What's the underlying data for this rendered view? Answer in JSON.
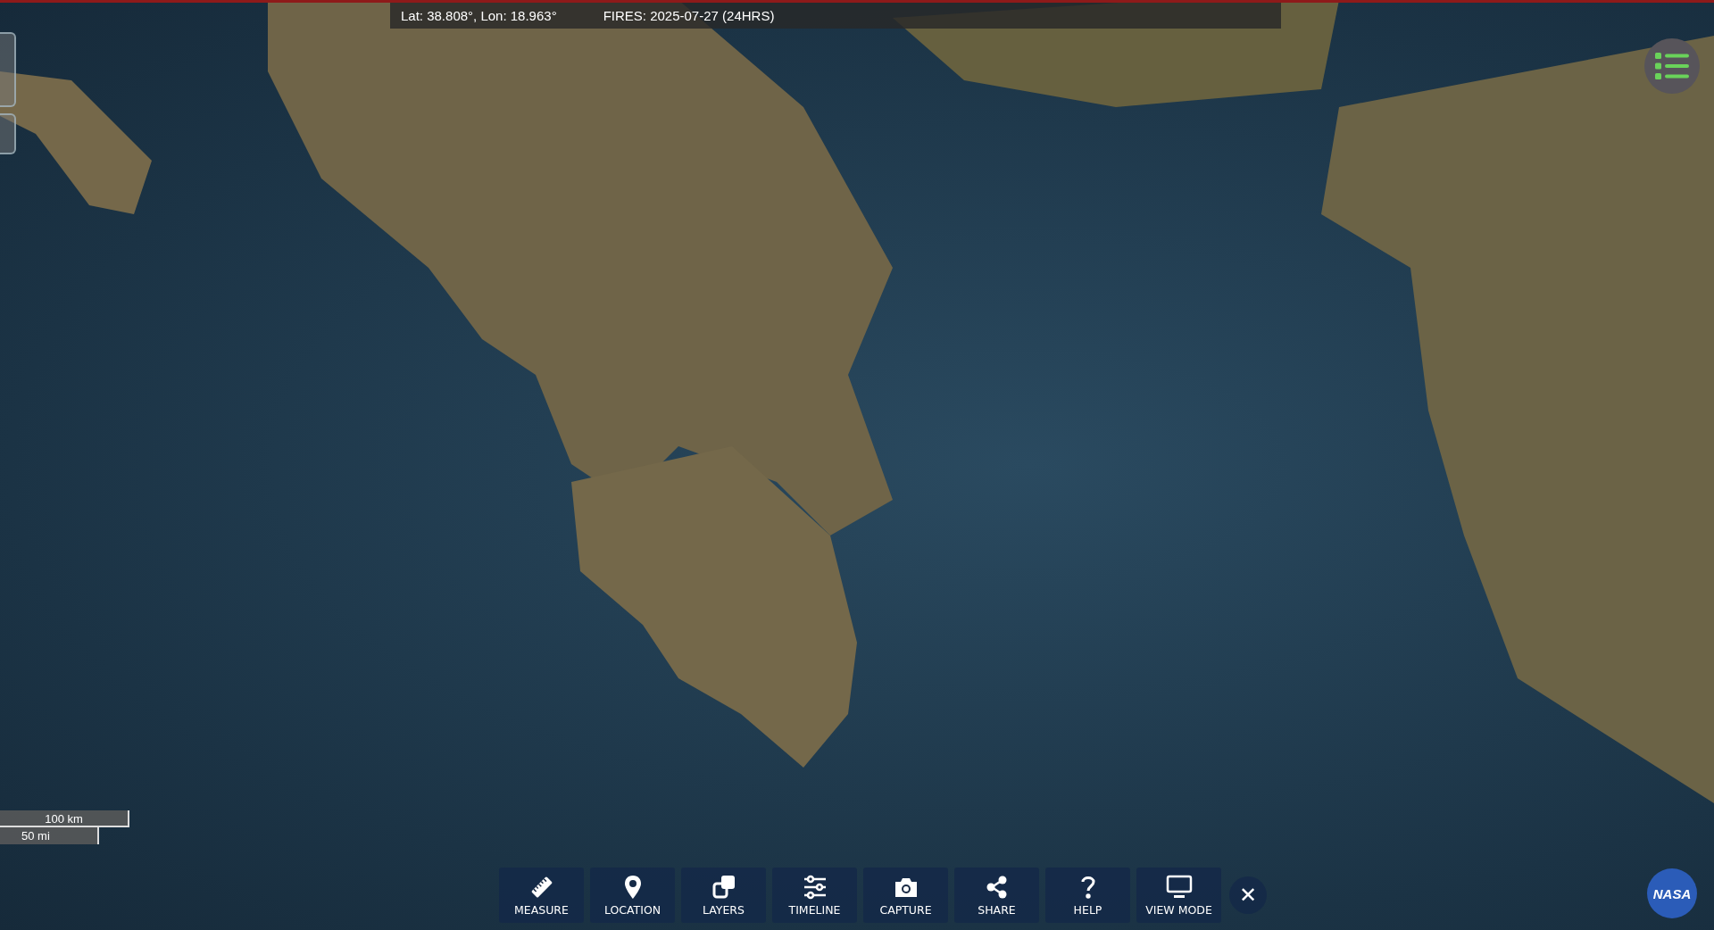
{
  "info_bar": {
    "coordinates": "Lat: 38.808°, Lon: 18.963°",
    "layer_info": "FIRES: 2025-07-27 (24HRS)"
  },
  "scale": {
    "metric": "100 km",
    "imperial": "50 mi"
  },
  "toolbar": [
    {
      "label": "MEASURE",
      "kind": "ruler"
    },
    {
      "label": "LOCATION",
      "kind": "pin"
    },
    {
      "label": "LAYERS",
      "kind": "layers"
    },
    {
      "label": "TIMELINE",
      "kind": "sliders"
    },
    {
      "label": "CAPTURE",
      "kind": "camera"
    },
    {
      "label": "SHARE",
      "kind": "share"
    },
    {
      "label": "HELP",
      "kind": "help"
    },
    {
      "label": "VIEW MODE",
      "kind": "monitor"
    }
  ],
  "close_button": "✕",
  "logo_text": "NASA"
}
